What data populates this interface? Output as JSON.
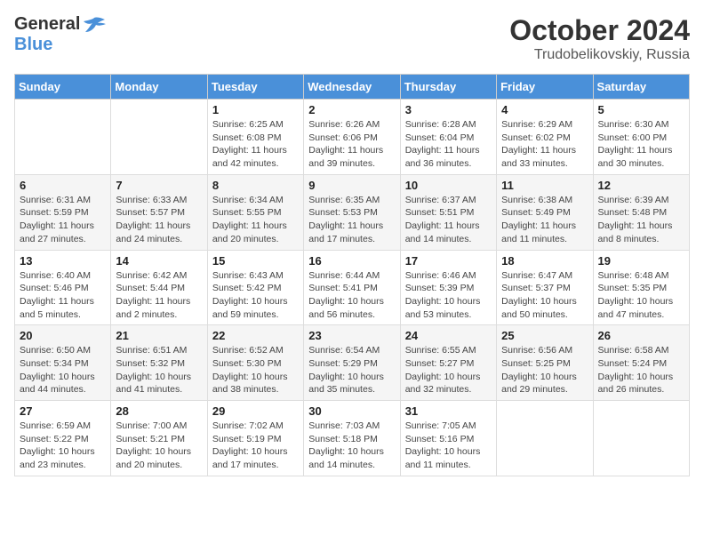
{
  "header": {
    "logo_general": "General",
    "logo_blue": "Blue",
    "month": "October 2024",
    "location": "Trudobelikovskiy, Russia"
  },
  "days_of_week": [
    "Sunday",
    "Monday",
    "Tuesday",
    "Wednesday",
    "Thursday",
    "Friday",
    "Saturday"
  ],
  "weeks": [
    [
      {
        "day": "",
        "info": ""
      },
      {
        "day": "",
        "info": ""
      },
      {
        "day": "1",
        "info": "Sunrise: 6:25 AM\nSunset: 6:08 PM\nDaylight: 11 hours and 42 minutes."
      },
      {
        "day": "2",
        "info": "Sunrise: 6:26 AM\nSunset: 6:06 PM\nDaylight: 11 hours and 39 minutes."
      },
      {
        "day": "3",
        "info": "Sunrise: 6:28 AM\nSunset: 6:04 PM\nDaylight: 11 hours and 36 minutes."
      },
      {
        "day": "4",
        "info": "Sunrise: 6:29 AM\nSunset: 6:02 PM\nDaylight: 11 hours and 33 minutes."
      },
      {
        "day": "5",
        "info": "Sunrise: 6:30 AM\nSunset: 6:00 PM\nDaylight: 11 hours and 30 minutes."
      }
    ],
    [
      {
        "day": "6",
        "info": "Sunrise: 6:31 AM\nSunset: 5:59 PM\nDaylight: 11 hours and 27 minutes."
      },
      {
        "day": "7",
        "info": "Sunrise: 6:33 AM\nSunset: 5:57 PM\nDaylight: 11 hours and 24 minutes."
      },
      {
        "day": "8",
        "info": "Sunrise: 6:34 AM\nSunset: 5:55 PM\nDaylight: 11 hours and 20 minutes."
      },
      {
        "day": "9",
        "info": "Sunrise: 6:35 AM\nSunset: 5:53 PM\nDaylight: 11 hours and 17 minutes."
      },
      {
        "day": "10",
        "info": "Sunrise: 6:37 AM\nSunset: 5:51 PM\nDaylight: 11 hours and 14 minutes."
      },
      {
        "day": "11",
        "info": "Sunrise: 6:38 AM\nSunset: 5:49 PM\nDaylight: 11 hours and 11 minutes."
      },
      {
        "day": "12",
        "info": "Sunrise: 6:39 AM\nSunset: 5:48 PM\nDaylight: 11 hours and 8 minutes."
      }
    ],
    [
      {
        "day": "13",
        "info": "Sunrise: 6:40 AM\nSunset: 5:46 PM\nDaylight: 11 hours and 5 minutes."
      },
      {
        "day": "14",
        "info": "Sunrise: 6:42 AM\nSunset: 5:44 PM\nDaylight: 11 hours and 2 minutes."
      },
      {
        "day": "15",
        "info": "Sunrise: 6:43 AM\nSunset: 5:42 PM\nDaylight: 10 hours and 59 minutes."
      },
      {
        "day": "16",
        "info": "Sunrise: 6:44 AM\nSunset: 5:41 PM\nDaylight: 10 hours and 56 minutes."
      },
      {
        "day": "17",
        "info": "Sunrise: 6:46 AM\nSunset: 5:39 PM\nDaylight: 10 hours and 53 minutes."
      },
      {
        "day": "18",
        "info": "Sunrise: 6:47 AM\nSunset: 5:37 PM\nDaylight: 10 hours and 50 minutes."
      },
      {
        "day": "19",
        "info": "Sunrise: 6:48 AM\nSunset: 5:35 PM\nDaylight: 10 hours and 47 minutes."
      }
    ],
    [
      {
        "day": "20",
        "info": "Sunrise: 6:50 AM\nSunset: 5:34 PM\nDaylight: 10 hours and 44 minutes."
      },
      {
        "day": "21",
        "info": "Sunrise: 6:51 AM\nSunset: 5:32 PM\nDaylight: 10 hours and 41 minutes."
      },
      {
        "day": "22",
        "info": "Sunrise: 6:52 AM\nSunset: 5:30 PM\nDaylight: 10 hours and 38 minutes."
      },
      {
        "day": "23",
        "info": "Sunrise: 6:54 AM\nSunset: 5:29 PM\nDaylight: 10 hours and 35 minutes."
      },
      {
        "day": "24",
        "info": "Sunrise: 6:55 AM\nSunset: 5:27 PM\nDaylight: 10 hours and 32 minutes."
      },
      {
        "day": "25",
        "info": "Sunrise: 6:56 AM\nSunset: 5:25 PM\nDaylight: 10 hours and 29 minutes."
      },
      {
        "day": "26",
        "info": "Sunrise: 6:58 AM\nSunset: 5:24 PM\nDaylight: 10 hours and 26 minutes."
      }
    ],
    [
      {
        "day": "27",
        "info": "Sunrise: 6:59 AM\nSunset: 5:22 PM\nDaylight: 10 hours and 23 minutes."
      },
      {
        "day": "28",
        "info": "Sunrise: 7:00 AM\nSunset: 5:21 PM\nDaylight: 10 hours and 20 minutes."
      },
      {
        "day": "29",
        "info": "Sunrise: 7:02 AM\nSunset: 5:19 PM\nDaylight: 10 hours and 17 minutes."
      },
      {
        "day": "30",
        "info": "Sunrise: 7:03 AM\nSunset: 5:18 PM\nDaylight: 10 hours and 14 minutes."
      },
      {
        "day": "31",
        "info": "Sunrise: 7:05 AM\nSunset: 5:16 PM\nDaylight: 10 hours and 11 minutes."
      },
      {
        "day": "",
        "info": ""
      },
      {
        "day": "",
        "info": ""
      }
    ]
  ]
}
